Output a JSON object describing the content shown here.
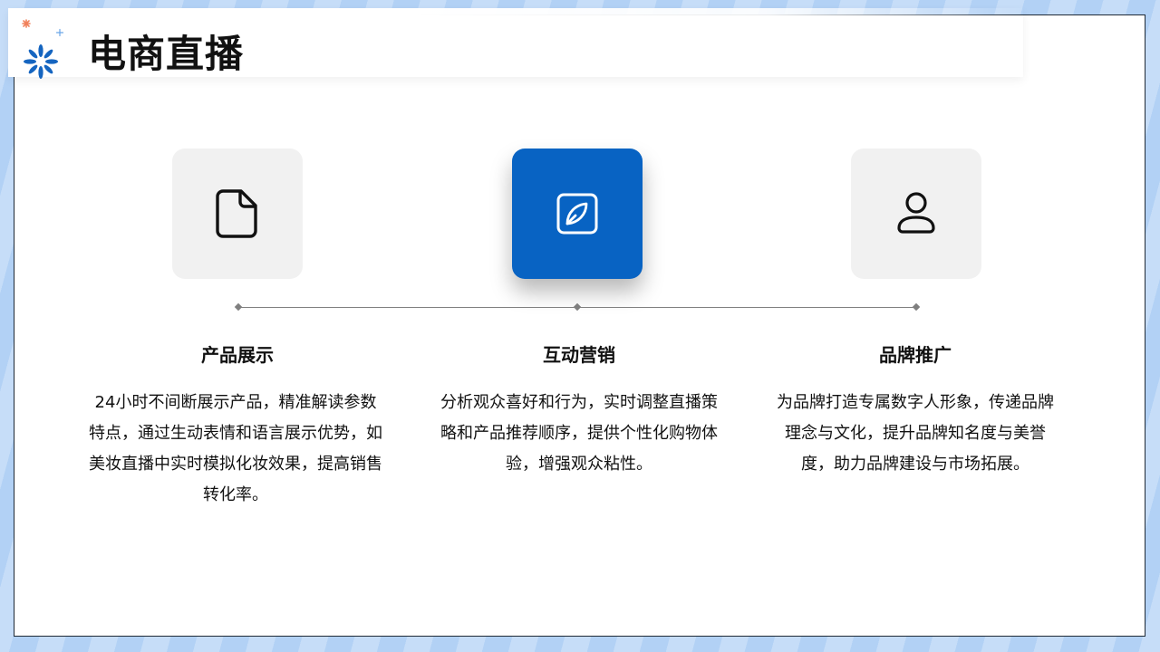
{
  "slide": {
    "title": "电商直播"
  },
  "features": [
    {
      "icon": "document-icon",
      "title": "产品展示",
      "description": "24小时不间断展示产品，精准解读参数特点，通过生动表情和语言展示优势，如美妆直播中实时模拟化妆效果，提高销售转化率。",
      "highlighted": false
    },
    {
      "icon": "edit-icon",
      "title": "互动营销",
      "description": "分析观众喜好和行为，实时调整直播策略和产品推荐顺序，提供个性化购物体验，增强观众粘性。",
      "highlighted": true
    },
    {
      "icon": "user-icon",
      "title": "品牌推广",
      "description": "为品牌打造专属数字人形象，传递品牌理念与文化，提升品牌知名度与美誉度，助力品牌建设与市场拓展。",
      "highlighted": false
    }
  ],
  "colors": {
    "accent": "#0863c3",
    "card_background": "#f1f1f1",
    "timeline": "#7f7f7f",
    "logo_blue": "#1565c0",
    "logo_orange": "#f0805a"
  }
}
